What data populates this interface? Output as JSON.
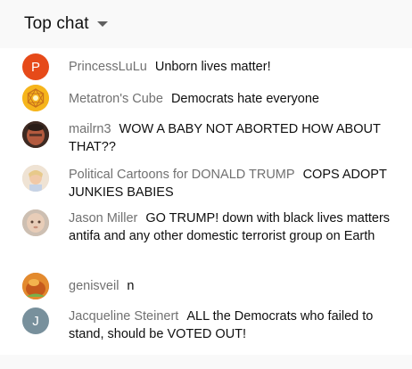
{
  "header": {
    "title": "Top chat",
    "caret_icon": "caret-down-icon"
  },
  "messages": [
    {
      "author": "PrincessLuLu",
      "text": "Unborn lives matter!",
      "avatar": {
        "kind": "letter",
        "letter": "P",
        "color": "#e64a19"
      }
    },
    {
      "author": "Metatron's Cube",
      "text": "Democrats hate everyone",
      "avatar": {
        "kind": "image",
        "icon": "metatron-cube-icon",
        "color": "#f5b21b"
      }
    },
    {
      "author": "mailrn3",
      "text": "WOW A BABY NOT ABORTED HOW ABOUT THAT??",
      "avatar": {
        "kind": "image",
        "icon": "photo-avatar",
        "color": "#7a3b2c"
      }
    },
    {
      "author": "Political Cartoons for DONALD TRUMP",
      "text": "COPS ADOPT JUNKIES BABIES",
      "avatar": {
        "kind": "image",
        "icon": "cartoon-avatar",
        "color": "#e9d9c6"
      }
    },
    {
      "author": "Jason Miller",
      "text": "GO TRUMP! down with black lives matters antifa and any other domestic terrorist group on Earth",
      "avatar": {
        "kind": "image",
        "icon": "baby-photo-avatar",
        "color": "#d8c2b0"
      }
    },
    {
      "author": "genisveil",
      "text": "n",
      "avatar": {
        "kind": "image",
        "icon": "orange-photo-avatar",
        "color": "#d9772a"
      }
    },
    {
      "author": "Jacqueline Steinert",
      "text": "ALL the Democrats who failed to stand, should be VOTED OUT!",
      "avatar": {
        "kind": "letter",
        "letter": "J",
        "color": "#78909c"
      }
    }
  ]
}
